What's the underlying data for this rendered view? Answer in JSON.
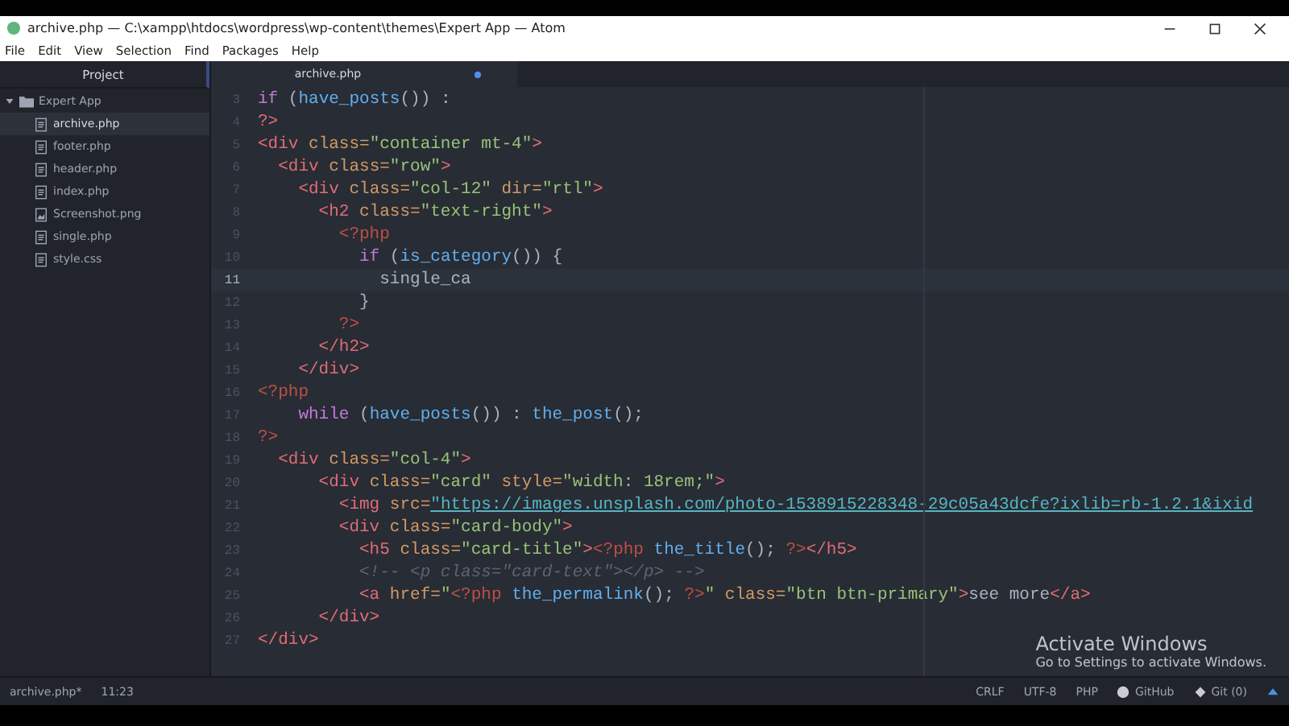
{
  "window": {
    "title": "archive.php — C:\\xampp\\htdocs\\wordpress\\wp-content\\themes\\Expert App — Atom"
  },
  "menu": [
    "File",
    "Edit",
    "View",
    "Selection",
    "Find",
    "Packages",
    "Help"
  ],
  "sidebar": {
    "title": "Project",
    "root": {
      "label": "Expert App",
      "expanded": true,
      "children": [
        {
          "label": "archive.php",
          "kind": "code",
          "selected": true
        },
        {
          "label": "footer.php",
          "kind": "code",
          "selected": false
        },
        {
          "label": "header.php",
          "kind": "code",
          "selected": false
        },
        {
          "label": "index.php",
          "kind": "code",
          "selected": false
        },
        {
          "label": "Screenshot.png",
          "kind": "image",
          "selected": false
        },
        {
          "label": "single.php",
          "kind": "code",
          "selected": false
        },
        {
          "label": "style.css",
          "kind": "code",
          "selected": false
        }
      ]
    }
  },
  "tabs": [
    {
      "label": "archive.php",
      "selected": true,
      "modified": true
    }
  ],
  "editor": {
    "lines": [
      {
        "number": "3",
        "current": false,
        "tokens": [
          {
            "kind": "kw",
            "text": "if "
          },
          {
            "kind": "punc",
            "text": "("
          },
          {
            "kind": "fn",
            "text": "have_posts"
          },
          {
            "kind": "punc",
            "text": "()) :"
          }
        ]
      },
      {
        "number": "4",
        "current": false,
        "tokens": [
          {
            "kind": "tag",
            "text": "?>"
          }
        ]
      },
      {
        "number": "5",
        "current": false,
        "tokens": [
          {
            "kind": "tag",
            "text": "<div "
          },
          {
            "kind": "attr",
            "text": "class="
          },
          {
            "kind": "str",
            "text": "\"container mt-4\""
          },
          {
            "kind": "tag",
            "text": ">"
          }
        ]
      },
      {
        "number": "6",
        "current": false,
        "tokens": [
          {
            "kind": "tag",
            "text": "  <div "
          },
          {
            "kind": "attr",
            "text": "class="
          },
          {
            "kind": "str",
            "text": "\"row\""
          },
          {
            "kind": "tag",
            "text": ">"
          }
        ]
      },
      {
        "number": "7",
        "current": false,
        "tokens": [
          {
            "kind": "tag",
            "text": "    <div "
          },
          {
            "kind": "attr",
            "text": "class="
          },
          {
            "kind": "str",
            "text": "\"col-12\" "
          },
          {
            "kind": "attr",
            "text": "dir="
          },
          {
            "kind": "str",
            "text": "\"rtl\""
          },
          {
            "kind": "tag",
            "text": ">"
          }
        ]
      },
      {
        "number": "8",
        "current": false,
        "tokens": [
          {
            "kind": "tag",
            "text": "      <h2 "
          },
          {
            "kind": "attr",
            "text": "class="
          },
          {
            "kind": "str",
            "text": "\"text-right\""
          },
          {
            "kind": "tag",
            "text": ">"
          }
        ]
      },
      {
        "number": "9",
        "current": false,
        "tokens": [
          {
            "kind": "php",
            "text": "        <?php"
          }
        ]
      },
      {
        "number": "10",
        "current": false,
        "tokens": [
          {
            "kind": "kw",
            "text": "          if "
          },
          {
            "kind": "punc",
            "text": "("
          },
          {
            "kind": "fn",
            "text": "is_category"
          },
          {
            "kind": "punc",
            "text": "()) {"
          }
        ]
      },
      {
        "number": "11",
        "current": true,
        "tokens": [
          {
            "kind": "punc",
            "text": "            single_ca"
          }
        ]
      },
      {
        "number": "12",
        "current": false,
        "tokens": [
          {
            "kind": "punc",
            "text": "          }"
          }
        ]
      },
      {
        "number": "13",
        "current": false,
        "tokens": [
          {
            "kind": "php",
            "text": "        ?>"
          }
        ]
      },
      {
        "number": "14",
        "current": false,
        "tokens": [
          {
            "kind": "tag",
            "text": "      </h2>"
          }
        ]
      },
      {
        "number": "15",
        "current": false,
        "tokens": [
          {
            "kind": "tag",
            "text": "    </div>"
          }
        ]
      },
      {
        "number": "16",
        "current": false,
        "tokens": [
          {
            "kind": "php",
            "text": "<?php"
          }
        ]
      },
      {
        "number": "17",
        "current": false,
        "tokens": [
          {
            "kind": "kw",
            "text": "    while "
          },
          {
            "kind": "punc",
            "text": "("
          },
          {
            "kind": "fn",
            "text": "have_posts"
          },
          {
            "kind": "punc",
            "text": "()) : "
          },
          {
            "kind": "fn",
            "text": "the_post"
          },
          {
            "kind": "punc",
            "text": "();"
          }
        ]
      },
      {
        "number": "18",
        "current": false,
        "tokens": [
          {
            "kind": "php",
            "text": "?>"
          }
        ]
      },
      {
        "number": "19",
        "current": false,
        "tokens": [
          {
            "kind": "tag",
            "text": "  <div "
          },
          {
            "kind": "attr",
            "text": "class="
          },
          {
            "kind": "str",
            "text": "\"col-4\""
          },
          {
            "kind": "tag",
            "text": ">"
          }
        ]
      },
      {
        "number": "20",
        "current": false,
        "tokens": [
          {
            "kind": "tag",
            "text": "      <div "
          },
          {
            "kind": "attr",
            "text": "class="
          },
          {
            "kind": "str",
            "text": "\"card\" "
          },
          {
            "kind": "attr",
            "text": "style="
          },
          {
            "kind": "str",
            "text": "\"width: 18rem;\""
          },
          {
            "kind": "tag",
            "text": ">"
          }
        ]
      },
      {
        "number": "21",
        "current": false,
        "tokens": [
          {
            "kind": "tag",
            "text": "        <img "
          },
          {
            "kind": "attr",
            "text": "src="
          },
          {
            "kind": "url",
            "text": "\"https://images.unsplash.com/photo-1538915228348-29c05a43dcfe?ixlib=rb-1.2.1&ixid"
          }
        ]
      },
      {
        "number": "22",
        "current": false,
        "tokens": [
          {
            "kind": "tag",
            "text": "        <div "
          },
          {
            "kind": "attr",
            "text": "class="
          },
          {
            "kind": "str",
            "text": "\"card-body\""
          },
          {
            "kind": "tag",
            "text": ">"
          }
        ]
      },
      {
        "number": "23",
        "current": false,
        "tokens": [
          {
            "kind": "tag",
            "text": "          <h5 "
          },
          {
            "kind": "attr",
            "text": "class="
          },
          {
            "kind": "str",
            "text": "\"card-title\""
          },
          {
            "kind": "tag",
            "text": ">"
          },
          {
            "kind": "php",
            "text": "<?php "
          },
          {
            "kind": "fn",
            "text": "the_title"
          },
          {
            "kind": "punc",
            "text": "(); "
          },
          {
            "kind": "php",
            "text": "?>"
          },
          {
            "kind": "tag",
            "text": "</h5>"
          }
        ]
      },
      {
        "number": "24",
        "current": false,
        "tokens": [
          {
            "kind": "comment",
            "text": "          <!-- <p class=\"card-text\"></p> -->"
          }
        ]
      },
      {
        "number": "25",
        "current": false,
        "tokens": [
          {
            "kind": "tag",
            "text": "          <a "
          },
          {
            "kind": "attr",
            "text": "href="
          },
          {
            "kind": "str",
            "text": "\""
          },
          {
            "kind": "php",
            "text": "<?php "
          },
          {
            "kind": "fn",
            "text": "the_permalink"
          },
          {
            "kind": "punc",
            "text": "(); "
          },
          {
            "kind": "php",
            "text": "?>"
          },
          {
            "kind": "str",
            "text": "\" "
          },
          {
            "kind": "attr",
            "text": "class="
          },
          {
            "kind": "str",
            "text": "\"btn btn-primary\""
          },
          {
            "kind": "tag",
            "text": ">"
          },
          {
            "kind": "punc",
            "text": "see more"
          },
          {
            "kind": "tag",
            "text": "</a>"
          }
        ]
      },
      {
        "number": "26",
        "current": false,
        "tokens": [
          {
            "kind": "tag",
            "text": "      </div>"
          }
        ]
      },
      {
        "number": "27",
        "current": false,
        "tokens": [
          {
            "kind": "tag",
            "text": "</div>"
          }
        ]
      }
    ]
  },
  "status_bar": {
    "file": "archive.php*",
    "cursor": "11:23",
    "line_ending": "CRLF",
    "encoding": "UTF-8",
    "grammar": "PHP",
    "github": "GitHub",
    "git": "Git (0)"
  },
  "activation": {
    "title": "Activate Windows",
    "text": "Go to Settings to activate Windows."
  }
}
